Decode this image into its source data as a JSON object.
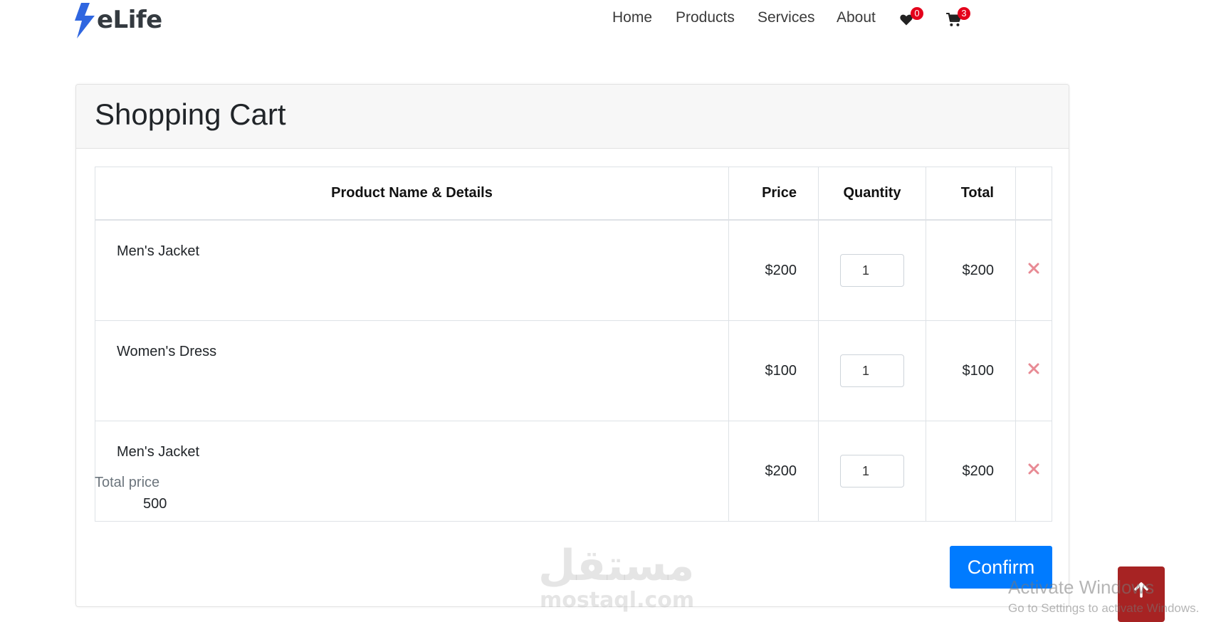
{
  "brand": {
    "name": "eLife",
    "accent": "#2f66e0"
  },
  "nav": {
    "home": "Home",
    "products": "Products",
    "services": "Services",
    "about": "About",
    "wishlist_count": "0",
    "cart_count": "3"
  },
  "cart": {
    "title": "Shopping Cart",
    "columns": {
      "name": "Product Name & Details",
      "price": "Price",
      "quantity": "Quantity",
      "total": "Total"
    },
    "rows": [
      {
        "name": "Men's Jacket",
        "price": "$200",
        "quantity": "1",
        "total": "$200"
      },
      {
        "name": "Women's Dress",
        "price": "$100",
        "quantity": "1",
        "total": "$100"
      },
      {
        "name": "Men's Jacket",
        "price": "$200",
        "quantity": "1",
        "total": "$200"
      }
    ],
    "total_label": "Total price",
    "total_value": "500",
    "confirm_label": "Confirm",
    "confirm_color": "#007bff",
    "remove_color": "#e88a94"
  },
  "watermark": {
    "arabic": "مستقل",
    "latin": "mostaql.com"
  },
  "back_to_top": {
    "color": "#a72323"
  },
  "os_overlay": {
    "title": "Activate Windows",
    "subtitle": "Go to Settings to activate Windows."
  }
}
